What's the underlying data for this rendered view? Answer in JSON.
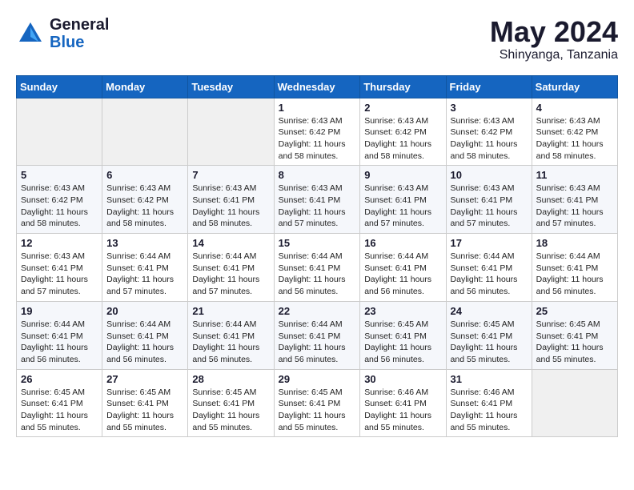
{
  "logo": {
    "general": "General",
    "blue": "Blue"
  },
  "title": {
    "month": "May 2024",
    "location": "Shinyanga, Tanzania"
  },
  "headers": [
    "Sunday",
    "Monday",
    "Tuesday",
    "Wednesday",
    "Thursday",
    "Friday",
    "Saturday"
  ],
  "weeks": [
    [
      {
        "day": "",
        "info": ""
      },
      {
        "day": "",
        "info": ""
      },
      {
        "day": "",
        "info": ""
      },
      {
        "day": "1",
        "info": "Sunrise: 6:43 AM\nSunset: 6:42 PM\nDaylight: 11 hours\nand 58 minutes."
      },
      {
        "day": "2",
        "info": "Sunrise: 6:43 AM\nSunset: 6:42 PM\nDaylight: 11 hours\nand 58 minutes."
      },
      {
        "day": "3",
        "info": "Sunrise: 6:43 AM\nSunset: 6:42 PM\nDaylight: 11 hours\nand 58 minutes."
      },
      {
        "day": "4",
        "info": "Sunrise: 6:43 AM\nSunset: 6:42 PM\nDaylight: 11 hours\nand 58 minutes."
      }
    ],
    [
      {
        "day": "5",
        "info": "Sunrise: 6:43 AM\nSunset: 6:42 PM\nDaylight: 11 hours\nand 58 minutes."
      },
      {
        "day": "6",
        "info": "Sunrise: 6:43 AM\nSunset: 6:42 PM\nDaylight: 11 hours\nand 58 minutes."
      },
      {
        "day": "7",
        "info": "Sunrise: 6:43 AM\nSunset: 6:41 PM\nDaylight: 11 hours\nand 58 minutes."
      },
      {
        "day": "8",
        "info": "Sunrise: 6:43 AM\nSunset: 6:41 PM\nDaylight: 11 hours\nand 57 minutes."
      },
      {
        "day": "9",
        "info": "Sunrise: 6:43 AM\nSunset: 6:41 PM\nDaylight: 11 hours\nand 57 minutes."
      },
      {
        "day": "10",
        "info": "Sunrise: 6:43 AM\nSunset: 6:41 PM\nDaylight: 11 hours\nand 57 minutes."
      },
      {
        "day": "11",
        "info": "Sunrise: 6:43 AM\nSunset: 6:41 PM\nDaylight: 11 hours\nand 57 minutes."
      }
    ],
    [
      {
        "day": "12",
        "info": "Sunrise: 6:43 AM\nSunset: 6:41 PM\nDaylight: 11 hours\nand 57 minutes."
      },
      {
        "day": "13",
        "info": "Sunrise: 6:44 AM\nSunset: 6:41 PM\nDaylight: 11 hours\nand 57 minutes."
      },
      {
        "day": "14",
        "info": "Sunrise: 6:44 AM\nSunset: 6:41 PM\nDaylight: 11 hours\nand 57 minutes."
      },
      {
        "day": "15",
        "info": "Sunrise: 6:44 AM\nSunset: 6:41 PM\nDaylight: 11 hours\nand 56 minutes."
      },
      {
        "day": "16",
        "info": "Sunrise: 6:44 AM\nSunset: 6:41 PM\nDaylight: 11 hours\nand 56 minutes."
      },
      {
        "day": "17",
        "info": "Sunrise: 6:44 AM\nSunset: 6:41 PM\nDaylight: 11 hours\nand 56 minutes."
      },
      {
        "day": "18",
        "info": "Sunrise: 6:44 AM\nSunset: 6:41 PM\nDaylight: 11 hours\nand 56 minutes."
      }
    ],
    [
      {
        "day": "19",
        "info": "Sunrise: 6:44 AM\nSunset: 6:41 PM\nDaylight: 11 hours\nand 56 minutes."
      },
      {
        "day": "20",
        "info": "Sunrise: 6:44 AM\nSunset: 6:41 PM\nDaylight: 11 hours\nand 56 minutes."
      },
      {
        "day": "21",
        "info": "Sunrise: 6:44 AM\nSunset: 6:41 PM\nDaylight: 11 hours\nand 56 minutes."
      },
      {
        "day": "22",
        "info": "Sunrise: 6:44 AM\nSunset: 6:41 PM\nDaylight: 11 hours\nand 56 minutes."
      },
      {
        "day": "23",
        "info": "Sunrise: 6:45 AM\nSunset: 6:41 PM\nDaylight: 11 hours\nand 56 minutes."
      },
      {
        "day": "24",
        "info": "Sunrise: 6:45 AM\nSunset: 6:41 PM\nDaylight: 11 hours\nand 55 minutes."
      },
      {
        "day": "25",
        "info": "Sunrise: 6:45 AM\nSunset: 6:41 PM\nDaylight: 11 hours\nand 55 minutes."
      }
    ],
    [
      {
        "day": "26",
        "info": "Sunrise: 6:45 AM\nSunset: 6:41 PM\nDaylight: 11 hours\nand 55 minutes."
      },
      {
        "day": "27",
        "info": "Sunrise: 6:45 AM\nSunset: 6:41 PM\nDaylight: 11 hours\nand 55 minutes."
      },
      {
        "day": "28",
        "info": "Sunrise: 6:45 AM\nSunset: 6:41 PM\nDaylight: 11 hours\nand 55 minutes."
      },
      {
        "day": "29",
        "info": "Sunrise: 6:45 AM\nSunset: 6:41 PM\nDaylight: 11 hours\nand 55 minutes."
      },
      {
        "day": "30",
        "info": "Sunrise: 6:46 AM\nSunset: 6:41 PM\nDaylight: 11 hours\nand 55 minutes."
      },
      {
        "day": "31",
        "info": "Sunrise: 6:46 AM\nSunset: 6:41 PM\nDaylight: 11 hours\nand 55 minutes."
      },
      {
        "day": "",
        "info": ""
      }
    ]
  ]
}
